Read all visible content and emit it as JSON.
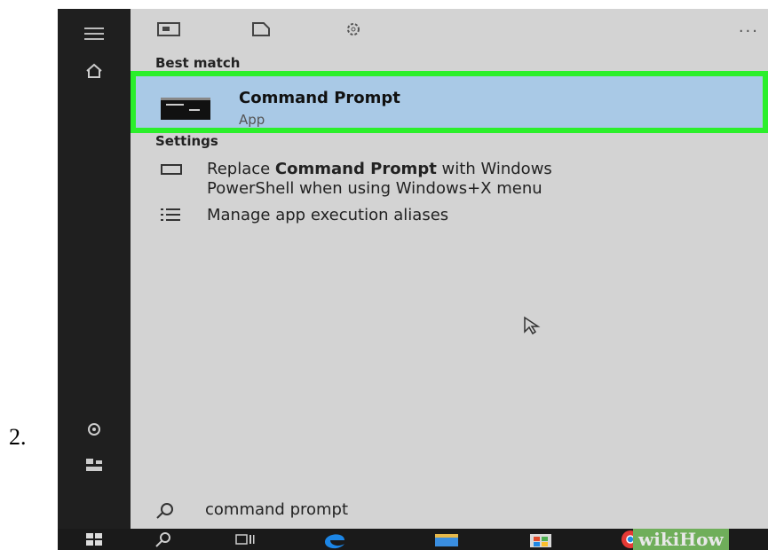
{
  "step": {
    "number": "2."
  },
  "best_match": {
    "section_label": "Best match",
    "title": "Command Prompt",
    "subtitle": "App"
  },
  "settings": {
    "section_label": "Settings",
    "items": [
      {
        "icon": "monitor-icon",
        "line1_pre": "Replace ",
        "line1_bold": "Command Prompt",
        "line1_post": " with Windows",
        "line2": "PowerShell when using Windows+X menu"
      },
      {
        "icon": "list-icon",
        "line1": "Manage app execution aliases"
      }
    ]
  },
  "search": {
    "query": "command prompt"
  },
  "topbar": {
    "more": "..."
  },
  "watermark": {
    "text": "wikiHow"
  },
  "colors": {
    "highlight_border": "#2bef2b",
    "highlight_fill": "#a9c9e6",
    "panel": "#d3d3d3",
    "rail": "#1f1f1f"
  }
}
